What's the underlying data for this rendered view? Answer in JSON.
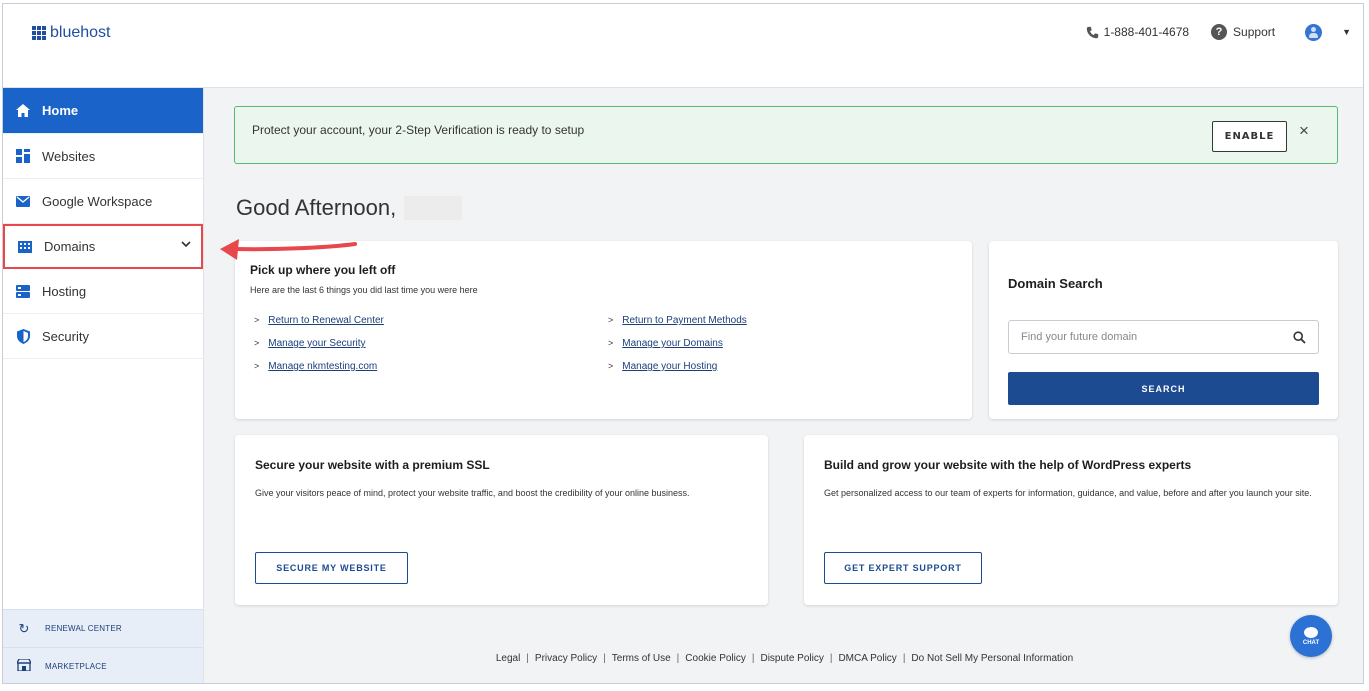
{
  "header": {
    "logo_text": "bluehost",
    "phone": "1-888-401-4678",
    "support_label": "Support"
  },
  "sidebar": {
    "items": [
      {
        "label": "Home",
        "icon": "home-icon"
      },
      {
        "label": "Websites",
        "icon": "websites-icon"
      },
      {
        "label": "Google Workspace",
        "icon": "mail-icon"
      },
      {
        "label": "Domains",
        "icon": "domains-icon"
      },
      {
        "label": "Hosting",
        "icon": "hosting-icon"
      },
      {
        "label": "Security",
        "icon": "shield-icon"
      }
    ],
    "bottom_links": [
      {
        "label": "RENEWAL CENTER",
        "icon": "refresh-icon"
      },
      {
        "label": "MARKETPLACE",
        "icon": "store-icon"
      }
    ]
  },
  "alert": {
    "message": "Protect your account, your 2-Step Verification is ready to setup",
    "enable_label": "ENABLE",
    "close_glyph": "×"
  },
  "greeting": "Good Afternoon,",
  "recent": {
    "title": "Pick up where you left off",
    "subtitle": "Here are the last 6 things you did last time you were here",
    "links_col1": [
      "Return to Renewal Center",
      "Manage your Security",
      "Manage nkmtesting.com"
    ],
    "links_col2": [
      "Return to Payment Methods",
      "Manage your Domains",
      "Manage your Hosting"
    ]
  },
  "domain_search": {
    "title": "Domain Search",
    "placeholder": "Find your future domain",
    "button_label": "SEARCH"
  },
  "ssl_card": {
    "title": "Secure your website with a premium SSL",
    "body": "Give your visitors peace of mind, protect your website traffic, and boost the credibility of your online business.",
    "button_label": "SECURE MY WEBSITE"
  },
  "wp_card": {
    "title": "Build and grow your website with the help of WordPress experts",
    "body": "Get personalized access to our team of experts for information, guidance, and value, before and after you launch your site.",
    "button_label": "GET EXPERT SUPPORT"
  },
  "footer": {
    "links": [
      "Legal",
      "Privacy Policy",
      "Terms of Use",
      "Cookie Policy",
      "Dispute Policy",
      "DMCA Policy",
      "Do Not Sell My Personal Information"
    ],
    "separator": "|"
  },
  "chat": {
    "label": "CHAT"
  },
  "colors": {
    "brand": "#1f4ea3",
    "active_nav": "#1a63c9",
    "alert_bg": "#ebf7ee",
    "alert_border": "#5ab872",
    "annotation_red": "#e8484c",
    "search_button": "#1c4b92"
  }
}
